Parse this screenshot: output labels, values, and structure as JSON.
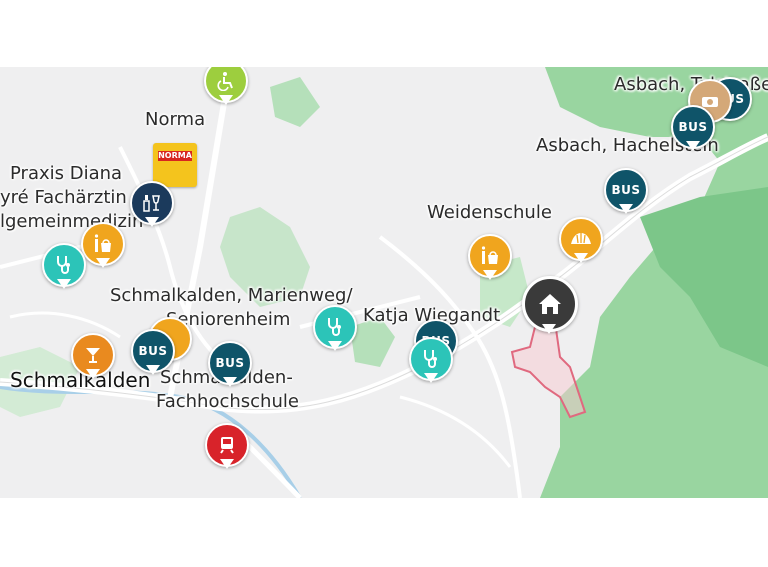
{
  "colors": {
    "bus": "#0f5469",
    "medical": "#2cc4b8",
    "shopping": "#f0a51e",
    "leisure": "#9dce3e",
    "bar": "#e98a1f",
    "train": "#d8232a",
    "wine": "#1b3a5c",
    "home": "#3a3a3a",
    "forest": "#8fd197",
    "boundary": "#e0697f"
  },
  "labels": {
    "norma": "Norma",
    "praxis_1": "Praxis Diana",
    "praxis_2": "yré Fachärztin fü",
    "praxis_3": "lgemeinmedizin",
    "marienweg_1": "Schmalkalden, Marienweg/",
    "marienweg_2": "Seniorenheim",
    "town": "Schmalkalden",
    "fh_1": "Schmalkalden-",
    "fh_2": "Fachhochschule",
    "katja": "Katja Wiegandt",
    "weidenschule": "Weidenschule",
    "talstrasse": "Asbach, Talstraße",
    "hachelstein": "Asbach, Hachelstein"
  },
  "pins": {
    "bus_label": "BUS",
    "norma_logo": "NORMA"
  },
  "icons": {
    "leisure": "wheelchair-activity-icon",
    "wine": "wine-bottle-icon",
    "shopping": "shopping-bag-icon",
    "medical": "stethoscope-icon",
    "bar": "cocktail-icon",
    "train": "train-icon",
    "bakery": "croissant-icon",
    "home": "home-icon"
  }
}
